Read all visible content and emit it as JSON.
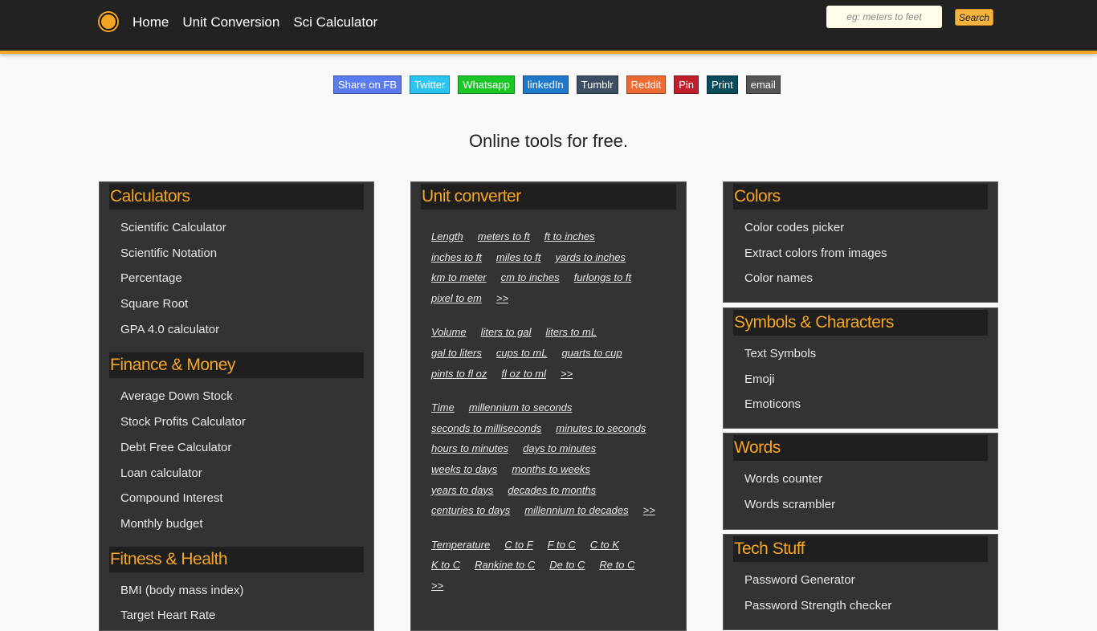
{
  "header": {
    "nav": [
      "Home",
      "Unit Conversion",
      "Sci Calculator"
    ],
    "search": {
      "placeholder": "eg: meters to feet",
      "button": "Search"
    }
  },
  "share": [
    {
      "label": "Share on FB",
      "color": "#5b7bf0"
    },
    {
      "label": "Twitter",
      "color": "#2bc4f0"
    },
    {
      "label": "Whatsapp",
      "color": "#1ac625"
    },
    {
      "label": "linkedIn",
      "color": "#1f78c8"
    },
    {
      "label": "Tumblr",
      "color": "#3d4e62"
    },
    {
      "label": "Reddit",
      "color": "#ee6a33"
    },
    {
      "label": "Pin",
      "color": "#c01e2a"
    },
    {
      "label": "Print",
      "color": "#0a4b5a"
    },
    {
      "label": "email",
      "color": "#555555"
    }
  ],
  "headline": "Online tools for free.",
  "left": {
    "calculators": {
      "title": "Calculators",
      "items": [
        "Scientific Calculator",
        "Scientific Notation",
        "Percentage",
        "Square Root",
        "GPA 4.0 calculator"
      ]
    },
    "finance": {
      "title": "Finance & Money",
      "items": [
        "Average Down Stock",
        "Stock Profits Calculator",
        "Debt Free Calculator",
        "Loan calculator",
        "Compound Interest",
        "Monthly budget"
      ]
    },
    "fitness": {
      "title": "Fitness & Health",
      "items": [
        "BMI (body mass index)",
        "Target Heart Rate"
      ]
    }
  },
  "unit": {
    "title": "Unit converter",
    "groups": [
      [
        [
          "Length",
          "meters to ft",
          "ft to inches"
        ],
        [
          "inches to ft",
          "miles to ft",
          "yards to inches"
        ],
        [
          "km to meter",
          "cm to inches",
          "furlongs to ft"
        ],
        [
          "pixel to em",
          ">>"
        ]
      ],
      [
        [
          "Volume",
          "liters to gal",
          "liters to mL"
        ],
        [
          "gal to liters",
          "cups to mL",
          "quarts to cup"
        ],
        [
          "pints to fl oz",
          "fl oz to ml",
          ">>"
        ]
      ],
      [
        [
          "Time",
          "millennium to seconds"
        ],
        [
          "seconds to milliseconds",
          "minutes to seconds"
        ],
        [
          "hours to minutes",
          "days to minutes"
        ],
        [
          "weeks to days",
          "months to weeks"
        ],
        [
          "years to days",
          "decades to months"
        ],
        [
          "centuries to days",
          "millennium to decades",
          ">>"
        ]
      ],
      [
        [
          "Temperature",
          "C to F",
          "F to C",
          "C to K"
        ],
        [
          "K to C",
          "Rankine to C",
          "De to C",
          "Re to C"
        ],
        [
          ">>"
        ]
      ]
    ]
  },
  "right": {
    "colors": {
      "title": "Colors",
      "items": [
        "Color codes picker",
        "Extract colors from images",
        "Color names"
      ]
    },
    "symbols": {
      "title": "Symbols & Characters",
      "items": [
        "Text Symbols",
        "Emoji",
        "Emoticons"
      ]
    },
    "words": {
      "title": "Words",
      "items": [
        "Words counter",
        "Words scrambler"
      ]
    },
    "tech": {
      "title": "Tech Stuff",
      "items": [
        "Password Generator",
        "Password Strength checker"
      ]
    }
  }
}
